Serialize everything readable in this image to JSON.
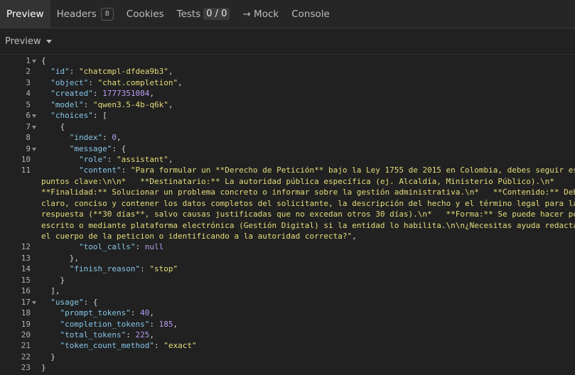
{
  "tabs": [
    {
      "label": "Preview",
      "active": true
    },
    {
      "label": "Headers",
      "badge": "8"
    },
    {
      "label": "Cookies"
    },
    {
      "label": "Tests",
      "count": "0 / 0"
    },
    {
      "label": "→ Mock"
    },
    {
      "label": "Console"
    }
  ],
  "toolbar": {
    "view_label": "Preview"
  },
  "json_lines": [
    {
      "n": "1",
      "fold": true,
      "tokens": [
        [
          "p",
          "{"
        ]
      ]
    },
    {
      "n": "2",
      "tokens": [
        [
          "p",
          "  "
        ],
        [
          "k",
          "\"id\""
        ],
        [
          "p",
          ": "
        ],
        [
          "s",
          "\"chatcmpl-dfdea9b3\""
        ],
        [
          "p",
          ","
        ]
      ]
    },
    {
      "n": "3",
      "tokens": [
        [
          "p",
          "  "
        ],
        [
          "k",
          "\"object\""
        ],
        [
          "p",
          ": "
        ],
        [
          "s",
          "\"chat.completion\""
        ],
        [
          "p",
          ","
        ]
      ]
    },
    {
      "n": "4",
      "tokens": [
        [
          "p",
          "  "
        ],
        [
          "k",
          "\"created\""
        ],
        [
          "p",
          ": "
        ],
        [
          "n",
          "1777351084"
        ],
        [
          "p",
          ","
        ]
      ]
    },
    {
      "n": "5",
      "tokens": [
        [
          "p",
          "  "
        ],
        [
          "k",
          "\"model\""
        ],
        [
          "p",
          ": "
        ],
        [
          "s",
          "\"qwen3.5-4b-q6k\""
        ],
        [
          "p",
          ","
        ]
      ]
    },
    {
      "n": "6",
      "fold": true,
      "tokens": [
        [
          "p",
          "  "
        ],
        [
          "k",
          "\"choices\""
        ],
        [
          "p",
          ": ["
        ]
      ]
    },
    {
      "n": "7",
      "fold": true,
      "tokens": [
        [
          "p",
          "    {"
        ]
      ]
    },
    {
      "n": "8",
      "tokens": [
        [
          "p",
          "      "
        ],
        [
          "k",
          "\"index\""
        ],
        [
          "p",
          ": "
        ],
        [
          "n",
          "0"
        ],
        [
          "p",
          ","
        ]
      ]
    },
    {
      "n": "9",
      "fold": true,
      "tokens": [
        [
          "p",
          "      "
        ],
        [
          "k",
          "\"message\""
        ],
        [
          "p",
          ": {"
        ]
      ]
    },
    {
      "n": "10",
      "tokens": [
        [
          "p",
          "        "
        ],
        [
          "k",
          "\"role\""
        ],
        [
          "p",
          ": "
        ],
        [
          "s",
          "\"assistant\""
        ],
        [
          "p",
          ","
        ]
      ]
    },
    {
      "n": "11",
      "tokens": [
        [
          "p",
          "        "
        ],
        [
          "k",
          "\"content\""
        ],
        [
          "p",
          ": "
        ],
        [
          "s",
          "\"Para formular un **Derecho de Petición** bajo la Ley 1755 de 2015 en Colombia, debes seguir estos"
        ]
      ]
    },
    {
      "n": "",
      "tokens": [
        [
          "s",
          "puntos clave:\\n\\n*   **Destinatario:** La autoridad pública específica (ej. Alcaldía, Ministerio Público).\\n*"
        ]
      ]
    },
    {
      "n": "",
      "tokens": [
        [
          "s",
          "**Finalidad:** Solucionar un problema concreto o informar sobre la gestión administrativa.\\n*   **Contenido:** Debe ser"
        ]
      ]
    },
    {
      "n": "",
      "tokens": [
        [
          "s",
          "claro, conciso y contener los datos completos del solicitante, la descripción del hecho y el término legal para la"
        ]
      ]
    },
    {
      "n": "",
      "tokens": [
        [
          "s",
          "respuesta (**30 días**, salvo causas justificadas que no excedan otros 30 días).\\n*   **Forma:** Se puede hacer por"
        ]
      ]
    },
    {
      "n": "",
      "tokens": [
        [
          "s",
          "escrito o mediante plataforma electrónica (Gestión Digital) si la entidad lo habilita.\\n\\n¿Necesitas ayuda redactando"
        ]
      ]
    },
    {
      "n": "",
      "tokens": [
        [
          "s",
          "el cuerpo de la peticion o identificando a la autoridad correcta?\""
        ],
        [
          "p",
          ","
        ]
      ]
    },
    {
      "n": "12",
      "tokens": [
        [
          "p",
          "        "
        ],
        [
          "k",
          "\"tool_calls\""
        ],
        [
          "p",
          ": "
        ],
        [
          "n",
          "null"
        ]
      ]
    },
    {
      "n": "13",
      "tokens": [
        [
          "p",
          "      },"
        ]
      ]
    },
    {
      "n": "14",
      "tokens": [
        [
          "p",
          "      "
        ],
        [
          "k",
          "\"finish_reason\""
        ],
        [
          "p",
          ": "
        ],
        [
          "s",
          "\"stop\""
        ]
      ]
    },
    {
      "n": "15",
      "tokens": [
        [
          "p",
          "    }"
        ]
      ]
    },
    {
      "n": "16",
      "tokens": [
        [
          "p",
          "  ],"
        ]
      ]
    },
    {
      "n": "17",
      "fold": true,
      "tokens": [
        [
          "p",
          "  "
        ],
        [
          "k",
          "\"usage\""
        ],
        [
          "p",
          ": {"
        ]
      ]
    },
    {
      "n": "18",
      "tokens": [
        [
          "p",
          "    "
        ],
        [
          "k",
          "\"prompt_tokens\""
        ],
        [
          "p",
          ": "
        ],
        [
          "n",
          "40"
        ],
        [
          "p",
          ","
        ]
      ]
    },
    {
      "n": "19",
      "tokens": [
        [
          "p",
          "    "
        ],
        [
          "k",
          "\"completion_tokens\""
        ],
        [
          "p",
          ": "
        ],
        [
          "n",
          "185"
        ],
        [
          "p",
          ","
        ]
      ]
    },
    {
      "n": "20",
      "tokens": [
        [
          "p",
          "    "
        ],
        [
          "k",
          "\"total_tokens\""
        ],
        [
          "p",
          ": "
        ],
        [
          "n",
          "225"
        ],
        [
          "p",
          ","
        ]
      ]
    },
    {
      "n": "21",
      "tokens": [
        [
          "p",
          "    "
        ],
        [
          "k",
          "\"token_count_method\""
        ],
        [
          "p",
          ": "
        ],
        [
          "s",
          "\"exact\""
        ]
      ]
    },
    {
      "n": "22",
      "tokens": [
        [
          "p",
          "  }"
        ]
      ]
    },
    {
      "n": "23",
      "tokens": [
        [
          "p",
          "}"
        ]
      ]
    }
  ]
}
